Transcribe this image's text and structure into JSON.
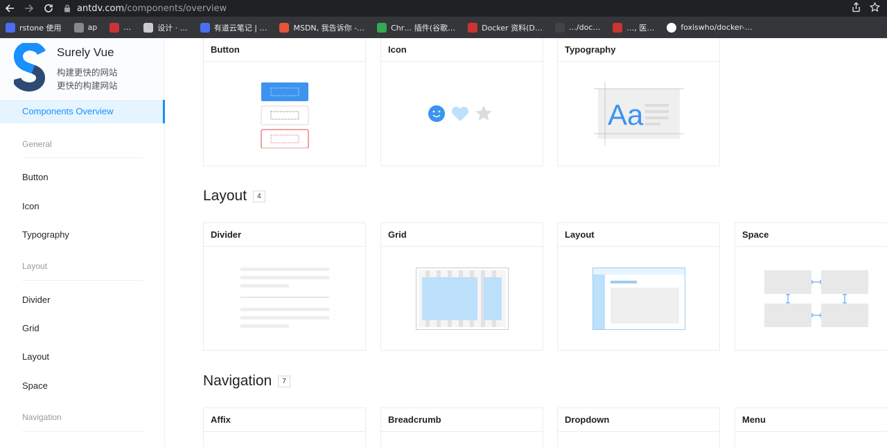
{
  "browser": {
    "url_host": "antdv.com",
    "url_path": "/components/overview",
    "bookmarks": [
      {
        "label": "rstone 使用",
        "color": "#4c6ef5"
      },
      {
        "label": "ap",
        "color": "#888888"
      },
      {
        "label": "…",
        "color": "#cc3333"
      },
      {
        "label": "设计 · …",
        "color": "#cccccc"
      },
      {
        "label": "有道云笔记 | …",
        "color": "#4c6ef5"
      },
      {
        "label": "MSDN, 我告诉你 -…",
        "color": "#e8533b"
      },
      {
        "label": "Chr… 插件(谷歌…",
        "color": "#34a853"
      },
      {
        "label": "Docker 资料(D…",
        "color": "#cc3333"
      },
      {
        "label": "…/doc…",
        "color": "#444444"
      },
      {
        "label": "…, 医…",
        "color": "#cc3333"
      },
      {
        "label": "foxiswho/docker-…",
        "color": "#ffffff"
      }
    ]
  },
  "sidebar": {
    "brand_title": "Surely Vue",
    "brand_sub1": "构建更快的网站",
    "brand_sub2": "更快的构建网站",
    "active_item": "Components Overview",
    "groups": [
      {
        "title": "General",
        "items": [
          "Button",
          "Icon",
          "Typography"
        ]
      },
      {
        "title": "Layout",
        "items": [
          "Divider",
          "Grid",
          "Layout",
          "Space"
        ]
      },
      {
        "title": "Navigation",
        "items": []
      }
    ]
  },
  "sections": [
    {
      "title": "",
      "count": "",
      "cards": [
        "Button",
        "Icon",
        "Typography"
      ]
    },
    {
      "title": "Layout",
      "count": "4",
      "cards": [
        "Divider",
        "Grid",
        "Layout",
        "Space"
      ]
    },
    {
      "title": "Navigation",
      "count": "7",
      "cards": [
        "Affix",
        "Breadcrumb",
        "Dropdown",
        "Menu"
      ]
    }
  ],
  "colors": {
    "accent": "#1890ff",
    "danger": "#e04444",
    "light_blue": "#bde0fb",
    "placeholder": "#efefef"
  }
}
